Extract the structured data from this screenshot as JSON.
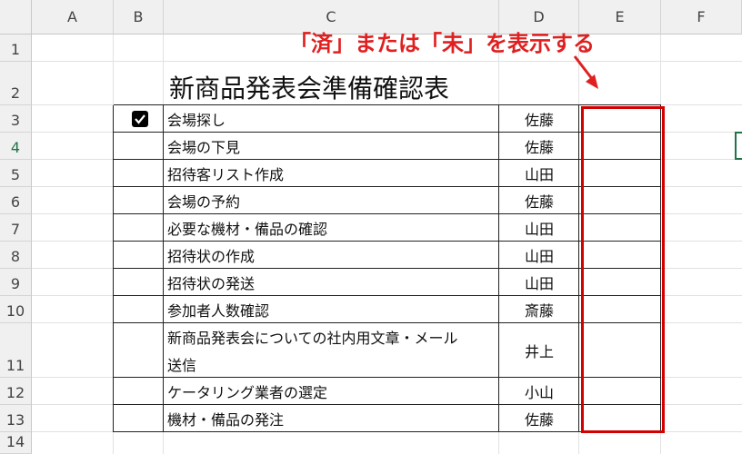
{
  "columns": [
    "A",
    "B",
    "C",
    "D",
    "E",
    "F"
  ],
  "rows": [
    "1",
    "2",
    "3",
    "4",
    "5",
    "6",
    "7",
    "8",
    "9",
    "10",
    "11",
    "12",
    "13",
    "14"
  ],
  "active_row": "4",
  "title": "新商品発表会準備確認表",
  "callout": "「済」または「未」を表示する",
  "accent_color": "#d40000",
  "tasks": [
    {
      "row": "3",
      "task": "会場探し",
      "person": "佐藤",
      "checked": true
    },
    {
      "row": "4",
      "task": "会場の下見",
      "person": "佐藤",
      "checked": false
    },
    {
      "row": "5",
      "task": "招待客リスト作成",
      "person": "山田",
      "checked": false
    },
    {
      "row": "6",
      "task": "会場の予約",
      "person": "佐藤",
      "checked": false
    },
    {
      "row": "7",
      "task": "必要な機材・備品の確認",
      "person": "山田",
      "checked": false
    },
    {
      "row": "8",
      "task": "招待状の作成",
      "person": "山田",
      "checked": false
    },
    {
      "row": "9",
      "task": "招待状の発送",
      "person": "山田",
      "checked": false
    },
    {
      "row": "10",
      "task": "参加者人数確認",
      "person": "斎藤",
      "checked": false
    },
    {
      "row": "11",
      "task": "新商品発表会についての社内用文章・メール",
      "task_line2": "送信",
      "person": "井上",
      "checked": false
    },
    {
      "row": "12",
      "task": "ケータリング業者の選定",
      "person": "小山",
      "checked": false
    },
    {
      "row": "13",
      "task": "機材・備品の発注",
      "person": "佐藤",
      "checked": false
    }
  ]
}
